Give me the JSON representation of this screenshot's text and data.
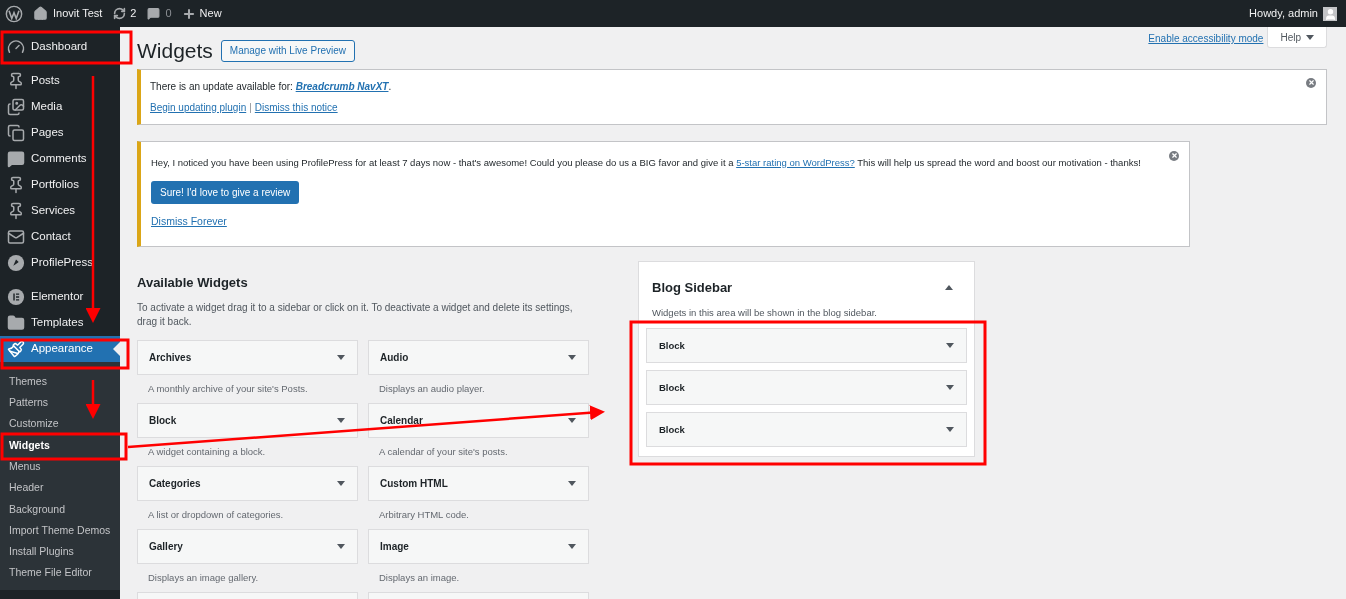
{
  "admin_bar": {
    "site_name": "Inovit Test",
    "updates_count": "2",
    "comments_count": "0",
    "new_label": "New",
    "greeting": "Howdy, admin"
  },
  "sidebar": {
    "menu_groups": [
      [
        {
          "label": "Dashboard",
          "selected": false
        },
        {
          "label": "Posts",
          "selected": false
        },
        {
          "label": "Media",
          "selected": false
        },
        {
          "label": "Pages",
          "selected": false
        },
        {
          "label": "Comments",
          "selected": false
        },
        {
          "label": "Portfolios",
          "selected": false
        },
        {
          "label": "Services",
          "selected": false
        },
        {
          "label": "Contact",
          "selected": false
        },
        {
          "label": "ProfilePress",
          "selected": false
        }
      ],
      [
        {
          "label": "Elementor",
          "selected": false
        },
        {
          "label": "Templates",
          "selected": false
        },
        {
          "label": "Appearance",
          "selected": true,
          "children": [
            {
              "label": "Themes",
              "selected": false
            },
            {
              "label": "Patterns",
              "selected": false
            },
            {
              "label": "Customize",
              "selected": false
            },
            {
              "label": "Widgets",
              "selected": true
            },
            {
              "label": "Menus",
              "selected": false
            },
            {
              "label": "Header",
              "selected": false
            },
            {
              "label": "Background",
              "selected": false
            },
            {
              "label": "Import Theme Demos",
              "selected": false
            },
            {
              "label": "Install Plugins",
              "selected": false
            },
            {
              "label": "Theme File Editor",
              "selected": false
            }
          ]
        }
      ]
    ]
  },
  "screen_options": {
    "accessibility_link": "Enable accessibility mode",
    "help_label": "Help"
  },
  "page": {
    "title": "Widgets",
    "action_button": "Manage with Live Preview"
  },
  "notices": [
    {
      "kind": "update",
      "text_before": "There is an update available for:",
      "link": "Breadcrumb NavXT",
      "text_after": ".",
      "actions": [
        "Begin updating plugin",
        "Dismiss this notice"
      ],
      "separator": "|"
    },
    {
      "kind": "review",
      "text_before": "Hey, I noticed you have been using ProfilePress for at least 7 days now - that's awesome! Could you please do us a BIG favor and give it a",
      "link": "5-star rating on WordPress?",
      "text_after": "This will help us spread the word and boost our motivation - thanks!",
      "button": "Sure! I'd love to give a review",
      "dismiss": "Dismiss Forever"
    }
  ],
  "available_widgets": {
    "title": "Available Widgets",
    "description": "To activate a widget drag it to a sidebar or click on it. To deactivate a widget and delete its settings, drag it back.",
    "widgets": [
      {
        "title": "Archives",
        "description": "A monthly archive of your site's Posts."
      },
      {
        "title": "Audio",
        "description": "Displays an audio player."
      },
      {
        "title": "Block",
        "description": "A widget containing a block."
      },
      {
        "title": "Calendar",
        "description": "A calendar of your site's posts."
      },
      {
        "title": "Categories",
        "description": "A list or dropdown of categories."
      },
      {
        "title": "Custom HTML",
        "description": "Arbitrary HTML code."
      },
      {
        "title": "Gallery",
        "description": "Displays an image gallery."
      },
      {
        "title": "Image",
        "description": "Displays an image."
      }
    ]
  },
  "widget_area": {
    "title": "Blog Sidebar",
    "expanded": true,
    "description": "Widgets in this area will be shown in the blog sidebar.",
    "widgets": [
      {
        "title": "Block"
      },
      {
        "title": "Block"
      },
      {
        "title": "Block"
      }
    ]
  }
}
